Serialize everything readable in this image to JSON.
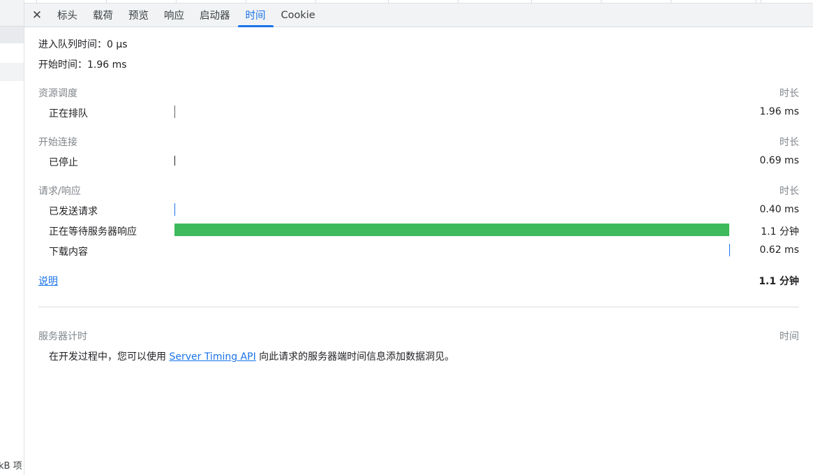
{
  "left_panel": {
    "summary": "kB 项"
  },
  "tabs": {
    "close_icon": "close-icon",
    "items": [
      "标头",
      "载荷",
      "预览",
      "响应",
      "启动器",
      "时间",
      "Cookie"
    ],
    "active": "时间"
  },
  "timing": {
    "queued_at": "进入队列时间：0 μs",
    "started_at": "开始时间：1.96 ms",
    "duration_header": "时长",
    "sections": [
      {
        "title": "资源调度",
        "rows": [
          {
            "label": "正在排队",
            "duration": "1.96 ms"
          }
        ]
      },
      {
        "title": "开始连接",
        "rows": [
          {
            "label": "已停止",
            "duration": "0.69 ms"
          }
        ]
      },
      {
        "title": "请求/响应",
        "rows": [
          {
            "label": "已发送请求",
            "duration": "0.40 ms"
          },
          {
            "label": "正在等待服务器响应",
            "duration": "1.1 分钟"
          },
          {
            "label": "下载内容",
            "duration": "0.62 ms"
          }
        ]
      }
    ],
    "explain_link": "说明",
    "total": "1.1 分钟"
  },
  "server_timing": {
    "title": "服务器计时",
    "header_right": "时间",
    "text_before": "在开发过程中，您可以使用 ",
    "link": "Server Timing API",
    "text_after": " 向此请求的服务器端时间信息添加数据洞见。"
  },
  "colors": {
    "accent": "#1a73e8",
    "waiting_bar": "#3dba5c"
  }
}
